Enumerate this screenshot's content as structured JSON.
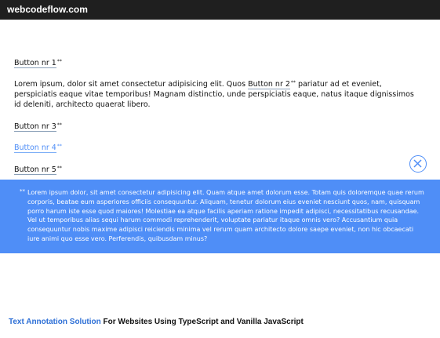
{
  "site": {
    "title": "webcodeflow.com"
  },
  "content": {
    "button1": "Button nr 1",
    "paragraph_before": "Lorem ipsum, dolor sit amet consectetur adipisicing elit. Quos ",
    "button2": "Button nr 2",
    "paragraph_after": " pariatur ad et eveniet, perspiciatis eaque vitae temporibus! Magnam distinctio, unde perspiciatis eaque, natus itaque dignissimos id deleniti, architecto quaerat libero.",
    "button3": "Button nr 3",
    "button4": "Button nr 4",
    "button5": "Button nr 5",
    "annotation_mark": "**"
  },
  "note": {
    "text": "Lorem ipsum dolor, sit amet consectetur adipisicing elit. Quam atque amet dolorum esse. Totam quis doloremque quae rerum corporis, beatae eum asperiores officiis consequuntur. Aliquam, tenetur dolorum eius eveniet nesciunt quos, nam, quisquam porro harum iste esse quod maiores! Molestiae ea atque facilis aperiam ratione impedit adipisci, necessitatibus recusandae. Vel ut temporibus alias sequi harum commodi reprehenderit, voluptate pariatur itaque omnis vero? Accusantium quia consequuntur nobis maxime adipisci reiciendis minima vel rerum quam architecto dolore saepe eveniet, non hic obcaecati iure animi quo esse vero. Perferendis, quibusdam minus?",
    "quote_mark": "**",
    "close_icon": "close-icon"
  },
  "footer": {
    "highlight": "Text Annotation Solution",
    "rest": " For Websites Using TypeScript and Vanilla JavaScript"
  },
  "colors": {
    "accent": "#4f8ef7",
    "topbar": "#1f1f1f"
  }
}
